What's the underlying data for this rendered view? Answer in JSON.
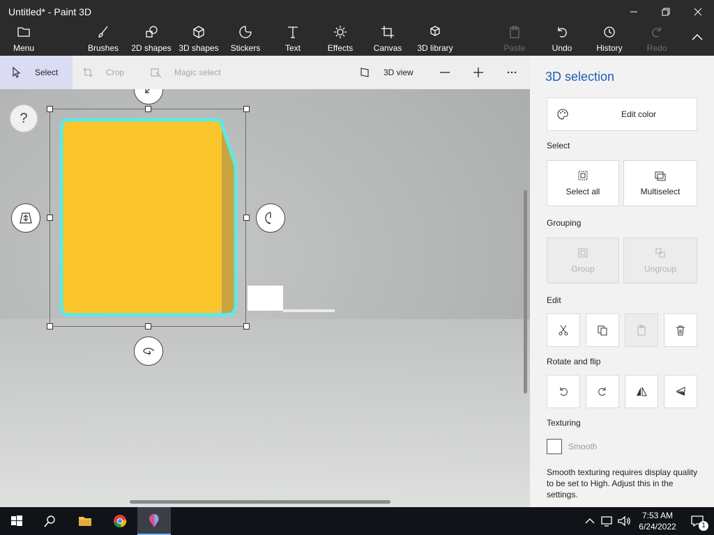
{
  "window": {
    "title": "Untitled* - Paint 3D"
  },
  "ribbon": [
    {
      "label": "Menu",
      "icon": "folder-icon"
    },
    {
      "label": "Brushes",
      "icon": "brush-icon"
    },
    {
      "label": "2D shapes",
      "icon": "2d-shapes-icon"
    },
    {
      "label": "3D shapes",
      "icon": "3d-shapes-icon"
    },
    {
      "label": "Stickers",
      "icon": "sticker-icon"
    },
    {
      "label": "Text",
      "icon": "text-icon"
    },
    {
      "label": "Effects",
      "icon": "effects-icon"
    },
    {
      "label": "Canvas",
      "icon": "canvas-icon"
    },
    {
      "label": "3D library",
      "icon": "3d-library-icon"
    },
    {
      "label": "Paste",
      "icon": "paste-icon",
      "disabled": true
    },
    {
      "label": "Undo",
      "icon": "undo-icon"
    },
    {
      "label": "History",
      "icon": "history-icon"
    },
    {
      "label": "Redo",
      "icon": "redo-icon",
      "disabled": true
    }
  ],
  "toolbar": {
    "select": "Select",
    "crop": "Crop",
    "magic_select": "Magic select",
    "view_3d": "3D view"
  },
  "canvas": {
    "help": "?"
  },
  "panel": {
    "title": "3D selection",
    "edit_color": "Edit color",
    "select_label": "Select",
    "select_all": "Select all",
    "multiselect": "Multiselect",
    "grouping_label": "Grouping",
    "group": "Group",
    "ungroup": "Ungroup",
    "edit_label": "Edit",
    "rotate_label": "Rotate and flip",
    "texturing_label": "Texturing",
    "smooth": "Smooth",
    "texture_note": "Smooth texturing requires display quality to be set to High. Adjust this in the settings."
  },
  "taskbar": {
    "time": "7:53 AM",
    "date": "6/24/2022",
    "notifications": "1"
  },
  "colors": {
    "accent": "#1a5fb4",
    "object_fill": "#fbc52c",
    "object_outline": "#5ee8e6"
  }
}
